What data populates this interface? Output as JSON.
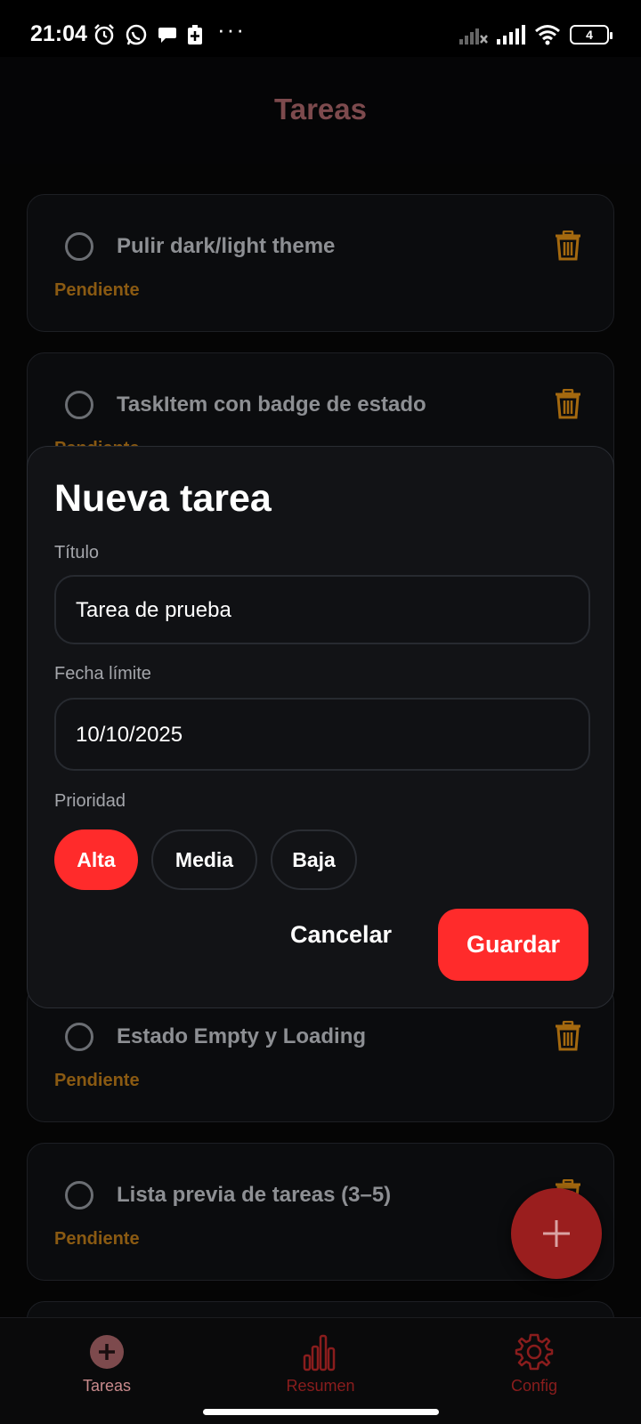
{
  "status_bar": {
    "time": "21:04",
    "left_icons": [
      "alarm-icon",
      "whatsapp-icon",
      "chat-bubble-icon",
      "battery-saver-icon"
    ],
    "more": "···",
    "right_icons": [
      "no-signal-icon",
      "signal-icon",
      "wifi-icon"
    ],
    "battery_level": "4"
  },
  "app": {
    "title": "Tareas"
  },
  "tasks": [
    {
      "title": "Pulir dark/light theme",
      "status": "Pendiente"
    },
    {
      "title": "TaskItem con badge de estado",
      "status": "Pendiente"
    },
    {
      "title": "Estado Empty y Loading",
      "status": "Pendiente"
    },
    {
      "title": "Lista previa de tareas (3–5)",
      "status": "Pendiente"
    }
  ],
  "modal": {
    "title": "Nueva tarea",
    "title_label": "Título",
    "title_value": "Tarea de prueba",
    "date_label": "Fecha límite",
    "date_value": "10/10/2025",
    "priority_label": "Prioridad",
    "priorities": [
      "Alta",
      "Media",
      "Baja"
    ],
    "selected_priority": "Alta",
    "cancel": "Cancelar",
    "save": "Guardar"
  },
  "nav": {
    "items": [
      {
        "label": "Tareas",
        "icon": "add-circle-icon",
        "active": true
      },
      {
        "label": "Resumen",
        "icon": "bar-chart-icon",
        "active": false
      },
      {
        "label": "Config",
        "icon": "gear-icon",
        "active": false
      }
    ]
  },
  "colors": {
    "accent": "#ff2b2b",
    "fab": "#9a1e1e",
    "pending": "#8a5a12",
    "trash": "#a4690f",
    "header_title": "#7d4a4d",
    "nav_active": "#7d4a4d",
    "nav_inactive": "#8a1d1d"
  }
}
